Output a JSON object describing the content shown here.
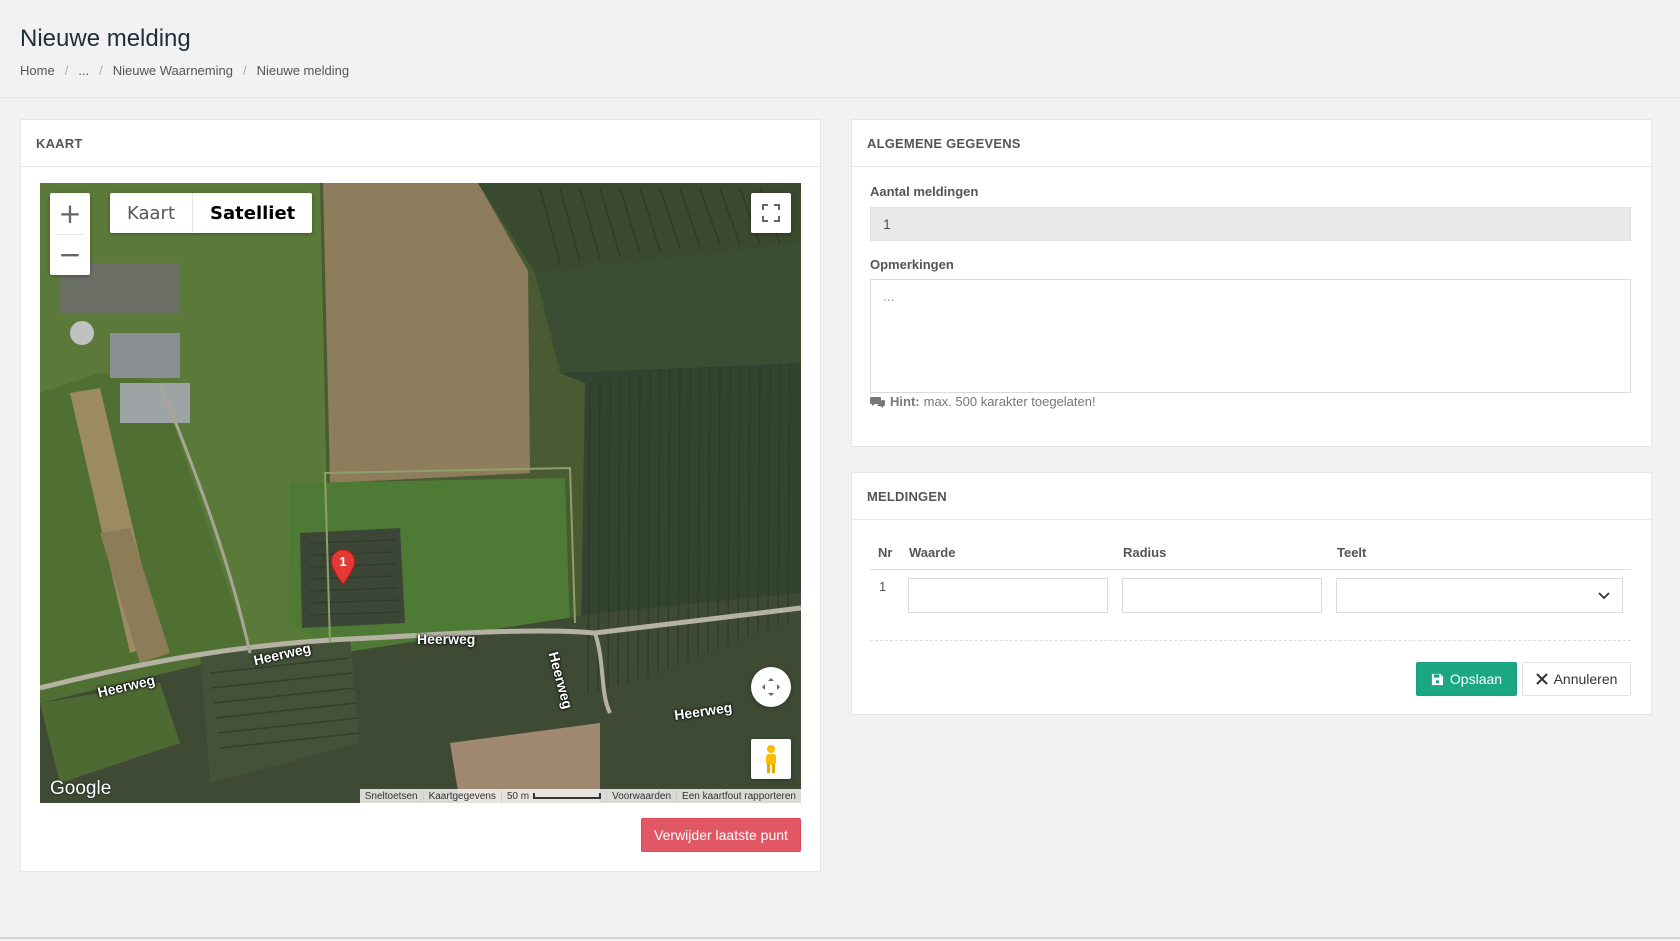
{
  "header": {
    "title": "Nieuwe melding",
    "breadcrumb": [
      "Home",
      "...",
      "Nieuwe Waarneming",
      "Nieuwe melding"
    ]
  },
  "map_panel": {
    "title": "KAART",
    "map_type_options": [
      "Kaart",
      "Satelliet"
    ],
    "map_type_selected": "Satelliet",
    "zoom_in": "+",
    "zoom_out": "−",
    "marker_label": "1",
    "road_labels": [
      "Heerweg",
      "Heerweg",
      "Heerweg",
      "Heerweg",
      "Heerweg"
    ],
    "logo": "Google",
    "attribution": [
      "Sneltoetsen",
      "Kaartgegevens",
      "50 m",
      "Voorwaarden",
      "Een kaartfout rapporteren"
    ],
    "delete_button": "Verwijder laatste punt"
  },
  "general_panel": {
    "title": "ALGEMENE GEGEVENS",
    "count_label": "Aantal meldingen",
    "count_value": "1",
    "remarks_label": "Opmerkingen",
    "remarks_placeholder": "...",
    "hint_bold": "Hint:",
    "hint_text": "max. 500 karakter toegelaten!"
  },
  "reports_panel": {
    "title": "MELDINGEN",
    "columns": [
      "Nr",
      "Waarde",
      "Radius",
      "Teelt"
    ],
    "rows": [
      {
        "nr": "1",
        "waarde": "",
        "radius": "",
        "teelt": ""
      }
    ],
    "save_button": "Opslaan",
    "cancel_button": "Annuleren"
  },
  "colors": {
    "success": "#1ba784",
    "danger": "#e15763",
    "marker": "#e53935"
  }
}
